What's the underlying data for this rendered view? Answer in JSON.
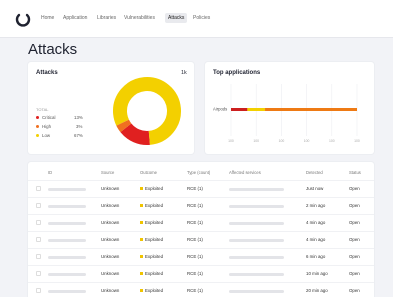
{
  "nav": {
    "items": [
      "Home",
      "Application",
      "Libraries",
      "Vulnerabilities",
      "Attacks",
      "Policies"
    ],
    "active_index": 4
  },
  "page": {
    "title": "Attacks"
  },
  "attacks_card": {
    "title": "Attacks",
    "count": "1k",
    "legend_header": "TOTAL",
    "legend": [
      {
        "label": "Critical",
        "pct": "13%",
        "color": "#e02020"
      },
      {
        "label": "High",
        "pct": "3%",
        "color": "#f07020"
      },
      {
        "label": "Low",
        "pct": "67%",
        "color": "#f3d000"
      }
    ]
  },
  "top_apps_card": {
    "title": "Top applications",
    "bar_label": "Airpods",
    "axis_ticks": [
      "100",
      "100",
      "100",
      "100",
      "100",
      "100"
    ]
  },
  "table": {
    "headers": [
      "ID",
      "Source",
      "Outcome",
      "Type (count)",
      "Affected services",
      "Detected",
      "Status"
    ],
    "rows": [
      {
        "source": "Unknown",
        "outcome": "Exploited",
        "type": "RCE (1)",
        "detected": "Just now",
        "status": "Open"
      },
      {
        "source": "Unknown",
        "outcome": "Exploited",
        "type": "RCE (1)",
        "detected": "2 min ago",
        "status": "Open"
      },
      {
        "source": "Unknown",
        "outcome": "Exploited",
        "type": "RCE (1)",
        "detected": "4 min ago",
        "status": "Open"
      },
      {
        "source": "Unknown",
        "outcome": "Exploited",
        "type": "RCE (1)",
        "detected": "4 min ago",
        "status": "Open"
      },
      {
        "source": "Unknown",
        "outcome": "Exploited",
        "type": "RCE (1)",
        "detected": "6 min ago",
        "status": "Open"
      },
      {
        "source": "Unknown",
        "outcome": "Exploited",
        "type": "RCE (1)",
        "detected": "10 min ago",
        "status": "Open"
      },
      {
        "source": "Unknown",
        "outcome": "Exploited",
        "type": "RCE (1)",
        "detected": "20 min ago",
        "status": "Open"
      }
    ]
  },
  "chart_data": [
    {
      "type": "pie",
      "title": "Attacks",
      "categories": [
        "Critical",
        "High",
        "Low"
      ],
      "values": [
        13,
        3,
        67
      ],
      "colors": [
        "#e02020",
        "#f07020",
        "#f3d000"
      ]
    },
    {
      "type": "bar",
      "title": "Top applications",
      "categories": [
        "Airpods"
      ],
      "series": [
        {
          "values": [
            13
          ],
          "color": "#cc1f1f"
        },
        {
          "values": [
            14
          ],
          "color": "#f3d000"
        },
        {
          "values": [
            73
          ],
          "color": "#ee7a14"
        }
      ]
    }
  ]
}
